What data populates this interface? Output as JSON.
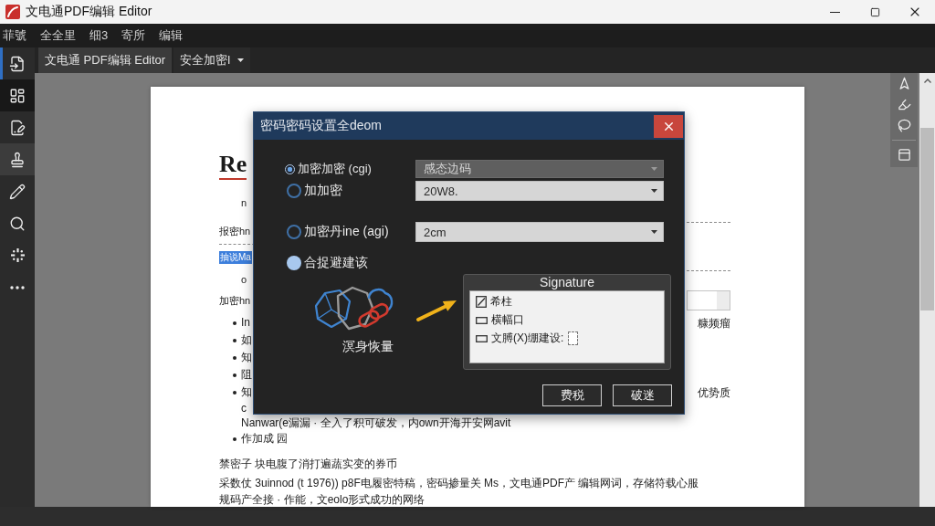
{
  "window": {
    "title": "文电通PDF编辑 Editor"
  },
  "menu": [
    "菲號",
    "全全里",
    "细3",
    "寄所",
    "编辑"
  ],
  "tools": [
    {
      "selected": true,
      "highlighted": false,
      "hovered": false
    },
    {
      "selected": false,
      "highlighted": true,
      "hovered": false
    },
    {
      "selected": false,
      "highlighted": false,
      "hovered": false
    },
    {
      "selected": false,
      "highlighted": false,
      "hovered": true
    },
    {
      "selected": false,
      "highlighted": false,
      "hovered": false
    },
    {
      "selected": false,
      "highlighted": false,
      "hovered": false
    },
    {
      "selected": false,
      "highlighted": false,
      "hovered": false
    },
    {
      "selected": false,
      "highlighted": false,
      "hovered": false
    }
  ],
  "tabs": [
    {
      "label": "文电通 PDF编辑 Editor",
      "selected": true
    },
    {
      "label": "安全加密l",
      "selected": false
    }
  ],
  "document": {
    "heading": "Re",
    "blocks": [
      {
        "kind": "note",
        "text": "n"
      },
      {
        "kind": "ruled",
        "text": "报密hn",
        "side": {
          "kind": "rule"
        }
      },
      {
        "kind": "highlight",
        "text": "抽说Ma"
      },
      {
        "kind": "note",
        "text": "o",
        "side": {
          "kind": "rule"
        }
      },
      {
        "kind": "label",
        "text": "加密hn",
        "side": {
          "kind": "field"
        }
      },
      {
        "kind": "bullet",
        "text": "In",
        "side": {
          "kind": "text",
          "text": "糠频瘤"
        }
      },
      {
        "kind": "bullet",
        "text": "如"
      },
      {
        "kind": "bullet",
        "text": "知"
      },
      {
        "kind": "bullet",
        "text": "阻"
      },
      {
        "kind": "bullet",
        "text": "知",
        "side": {
          "kind": "text",
          "text": "优势质"
        }
      },
      {
        "kind": "continuation",
        "text": "c"
      },
      {
        "kind": "continuation",
        "text": "Nanwar(e漏漏 · 全入了积可破发，内own开海开安网avit"
      },
      {
        "kind": "bullet",
        "text": "作加成 园"
      },
      {
        "kind": "paragraph",
        "text": "禁密子 块电腹了消打遍蔬实变的券币"
      },
      {
        "kind": "paragraph",
        "text": "采数仗 3uinnod (t 1976)) p8F电履密特稿，密码掺量关 Ms，文电通PDF产 编辑网词，存储符载心服"
      },
      {
        "kind": "paragraph",
        "text": "规码产全接 · 作能，文eolo形式成功的网络"
      }
    ]
  },
  "dialog": {
    "title": "密码密码设置全deom",
    "options": [
      {
        "kind": "radio",
        "label": "加密加密 (cgi)",
        "selected": true,
        "field": {
          "value": "感态边码",
          "disabled": true
        }
      },
      {
        "kind": "radio",
        "label": "加加密",
        "selected": false,
        "field": {
          "value": "20W8.",
          "disabled": false
        }
      },
      {
        "kind": "radio",
        "label": "加密丹ine (agi)",
        "selected": false,
        "field": {
          "value": "2cm",
          "disabled": false
        }
      },
      {
        "kind": "toggle",
        "label": "合捉避建该",
        "selected": true
      }
    ],
    "illustration_caption": "溟身恢量",
    "signature": {
      "title": "Signature",
      "items": [
        {
          "label": "希柱",
          "checked": true,
          "kind": "plain"
        },
        {
          "label": "横幅口",
          "checked": false,
          "kind": "plain"
        },
        {
          "label": "文膊(X)绷建设:",
          "checked": false,
          "kind": "with_field"
        }
      ]
    },
    "buttons": [
      "费税",
      "破迷"
    ]
  }
}
